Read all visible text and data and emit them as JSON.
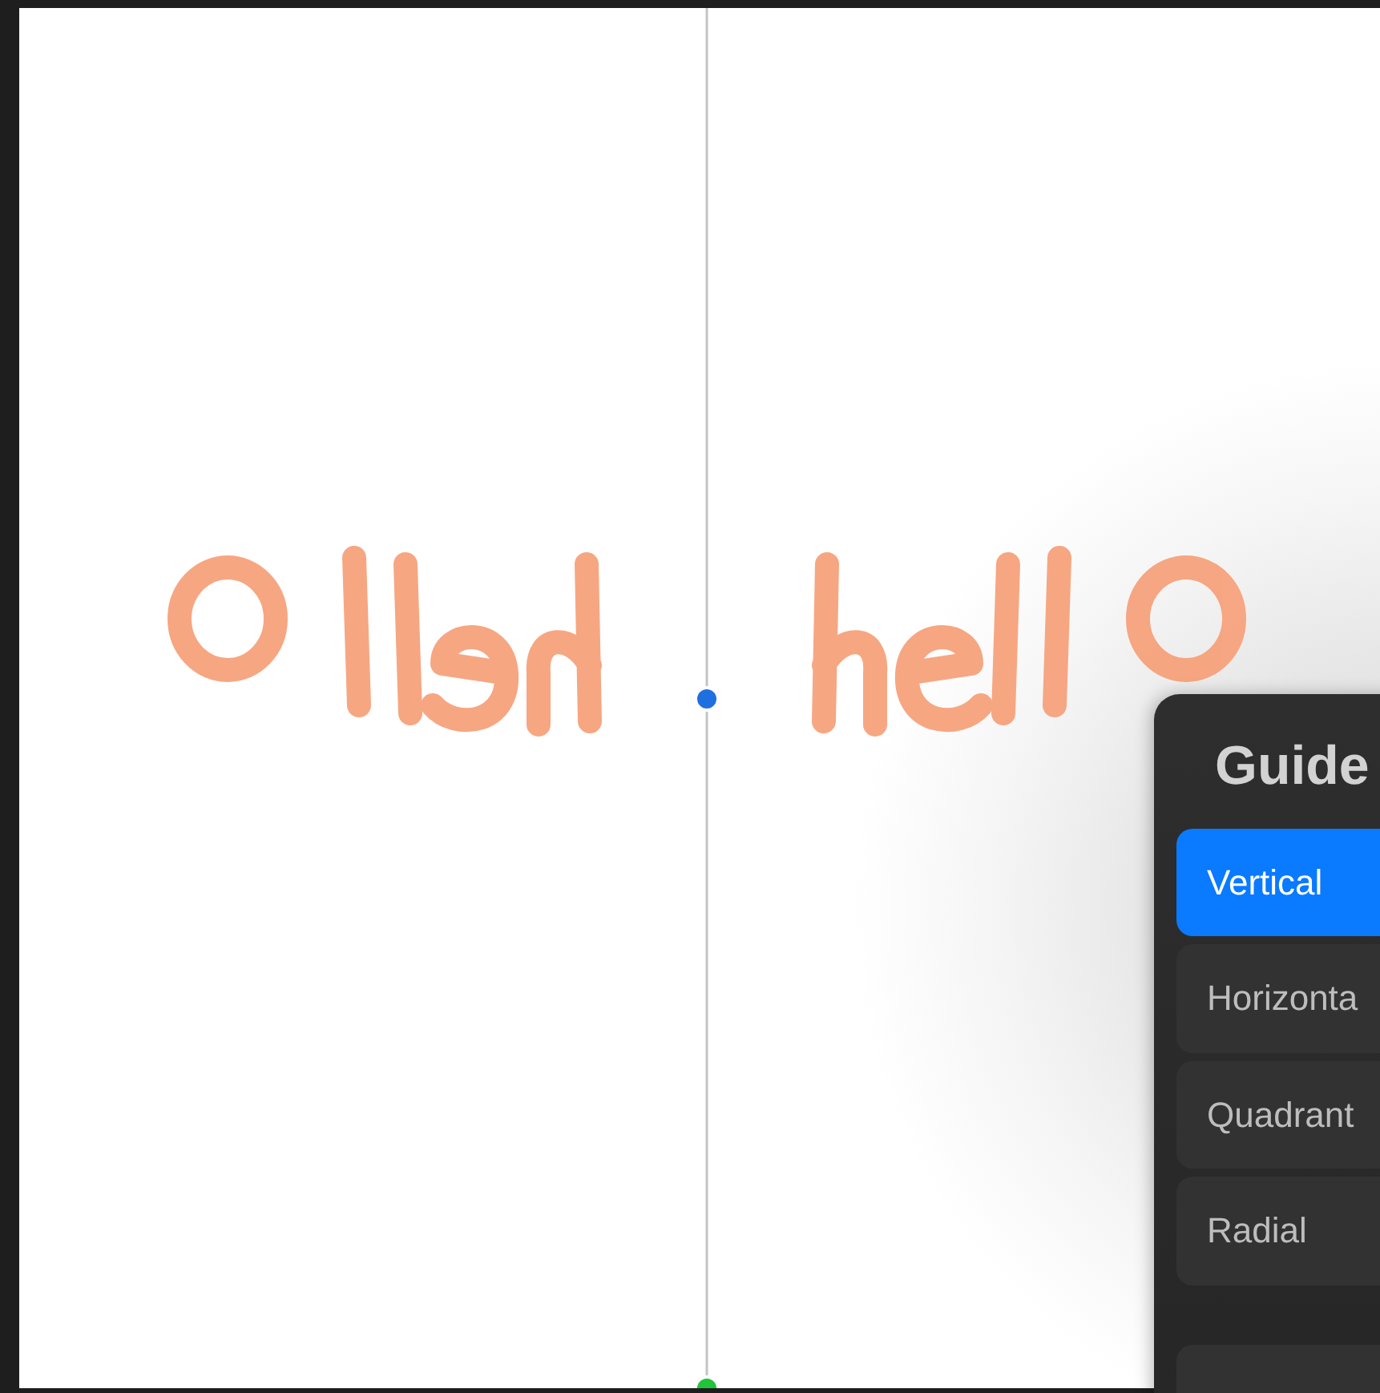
{
  "panel": {
    "title": "Guide",
    "options": [
      {
        "label": "Vertical",
        "selected": true
      },
      {
        "label": "Horizonta",
        "selected": false
      },
      {
        "label": "Quadrant",
        "selected": false
      },
      {
        "label": "Radial",
        "selected": false
      }
    ]
  }
}
